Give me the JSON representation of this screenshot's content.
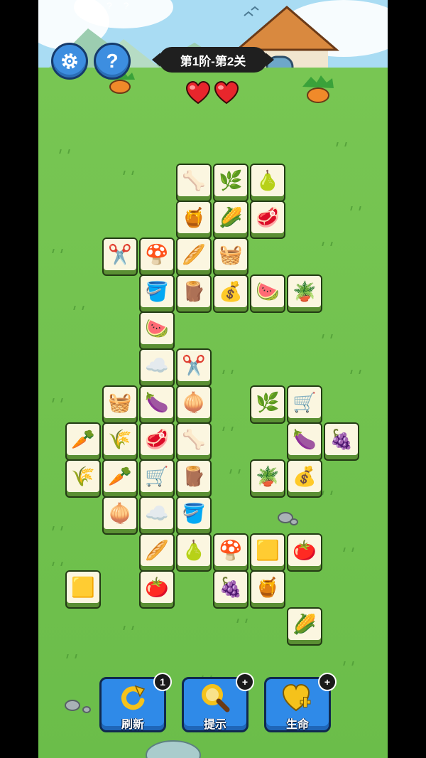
{
  "header": {
    "level_text": "第1阶-第2关",
    "settings_icon": "gear-icon",
    "help_label": "?",
    "top_marks": "? ?"
  },
  "lives": {
    "count": 2,
    "icon": "heart-icon",
    "color": "#e8262c"
  },
  "tiles": [
    {
      "item": "bone",
      "glyph": "🦴"
    },
    {
      "item": "grass",
      "glyph": "🌿"
    },
    {
      "item": "pear",
      "glyph": "🍐"
    },
    {
      "item": "honeycomb",
      "glyph": "🍯"
    },
    {
      "item": "corn",
      "glyph": "🌽"
    },
    {
      "item": "meat",
      "glyph": "🥩"
    },
    {
      "item": "scissors",
      "glyph": "✂️"
    },
    {
      "item": "mushroom",
      "glyph": "🍄"
    },
    {
      "item": "bread",
      "glyph": "🥖"
    },
    {
      "item": "basket",
      "glyph": "🧺"
    },
    {
      "item": "bucket",
      "glyph": "🪣"
    },
    {
      "item": "logs",
      "glyph": "🪵"
    },
    {
      "item": "seed-bag",
      "glyph": "💰"
    },
    {
      "item": "watermelon",
      "glyph": "🍉"
    },
    {
      "item": "potted-plant",
      "glyph": "🪴"
    },
    {
      "item": "watermelon",
      "glyph": "🍉"
    },
    {
      "item": "cotton",
      "glyph": "☁️"
    },
    {
      "item": "scissors",
      "glyph": "✂️"
    },
    {
      "item": "basket",
      "glyph": "🧺"
    },
    {
      "item": "eggplant",
      "glyph": "🍆"
    },
    {
      "item": "onion",
      "glyph": "🧅"
    },
    {
      "item": "grass",
      "glyph": "🌿"
    },
    {
      "item": "wheelbarrow",
      "glyph": "🛒"
    },
    {
      "item": "carrot",
      "glyph": "🥕"
    },
    {
      "item": "wheat",
      "glyph": "🌾"
    },
    {
      "item": "meat",
      "glyph": "🥩"
    },
    {
      "item": "bone",
      "glyph": "🦴"
    },
    {
      "item": "eggplant",
      "glyph": "🍆"
    },
    {
      "item": "grapes",
      "glyph": "🍇"
    },
    {
      "item": "wheat",
      "glyph": "🌾"
    },
    {
      "item": "carrot",
      "glyph": "🥕"
    },
    {
      "item": "wheelbarrow",
      "glyph": "🛒"
    },
    {
      "item": "logs",
      "glyph": "🪵"
    },
    {
      "item": "potted-plant",
      "glyph": "🪴"
    },
    {
      "item": "seed-bag",
      "glyph": "💰"
    },
    {
      "item": "onion",
      "glyph": "🧅"
    },
    {
      "item": "cotton",
      "glyph": "☁️"
    },
    {
      "item": "bucket",
      "glyph": "🪣"
    },
    {
      "item": "bread",
      "glyph": "🥖"
    },
    {
      "item": "pear",
      "glyph": "🍐"
    },
    {
      "item": "mushroom",
      "glyph": "🍄"
    },
    {
      "item": "hay-bale",
      "glyph": "🟨"
    },
    {
      "item": "tomato",
      "glyph": "🍅"
    },
    {
      "item": "hay-bale",
      "glyph": "🟨"
    },
    {
      "item": "tomato",
      "glyph": "🍅"
    },
    {
      "item": "grapes",
      "glyph": "🍇"
    },
    {
      "item": "honeycomb",
      "glyph": "🍯"
    },
    {
      "item": "corn",
      "glyph": "🌽"
    }
  ],
  "tools": {
    "refresh": {
      "label": "刷新",
      "badge": "1",
      "icon": "refresh-icon"
    },
    "hint": {
      "label": "提示",
      "badge": "+",
      "icon": "magnifier-icon"
    },
    "life": {
      "label": "生命",
      "badge": "+",
      "icon": "heart-plus-icon"
    }
  },
  "colors": {
    "grass": "#6fc04e",
    "tile_face": "#fbf6e0",
    "button_blue": "#2f8ae8"
  }
}
